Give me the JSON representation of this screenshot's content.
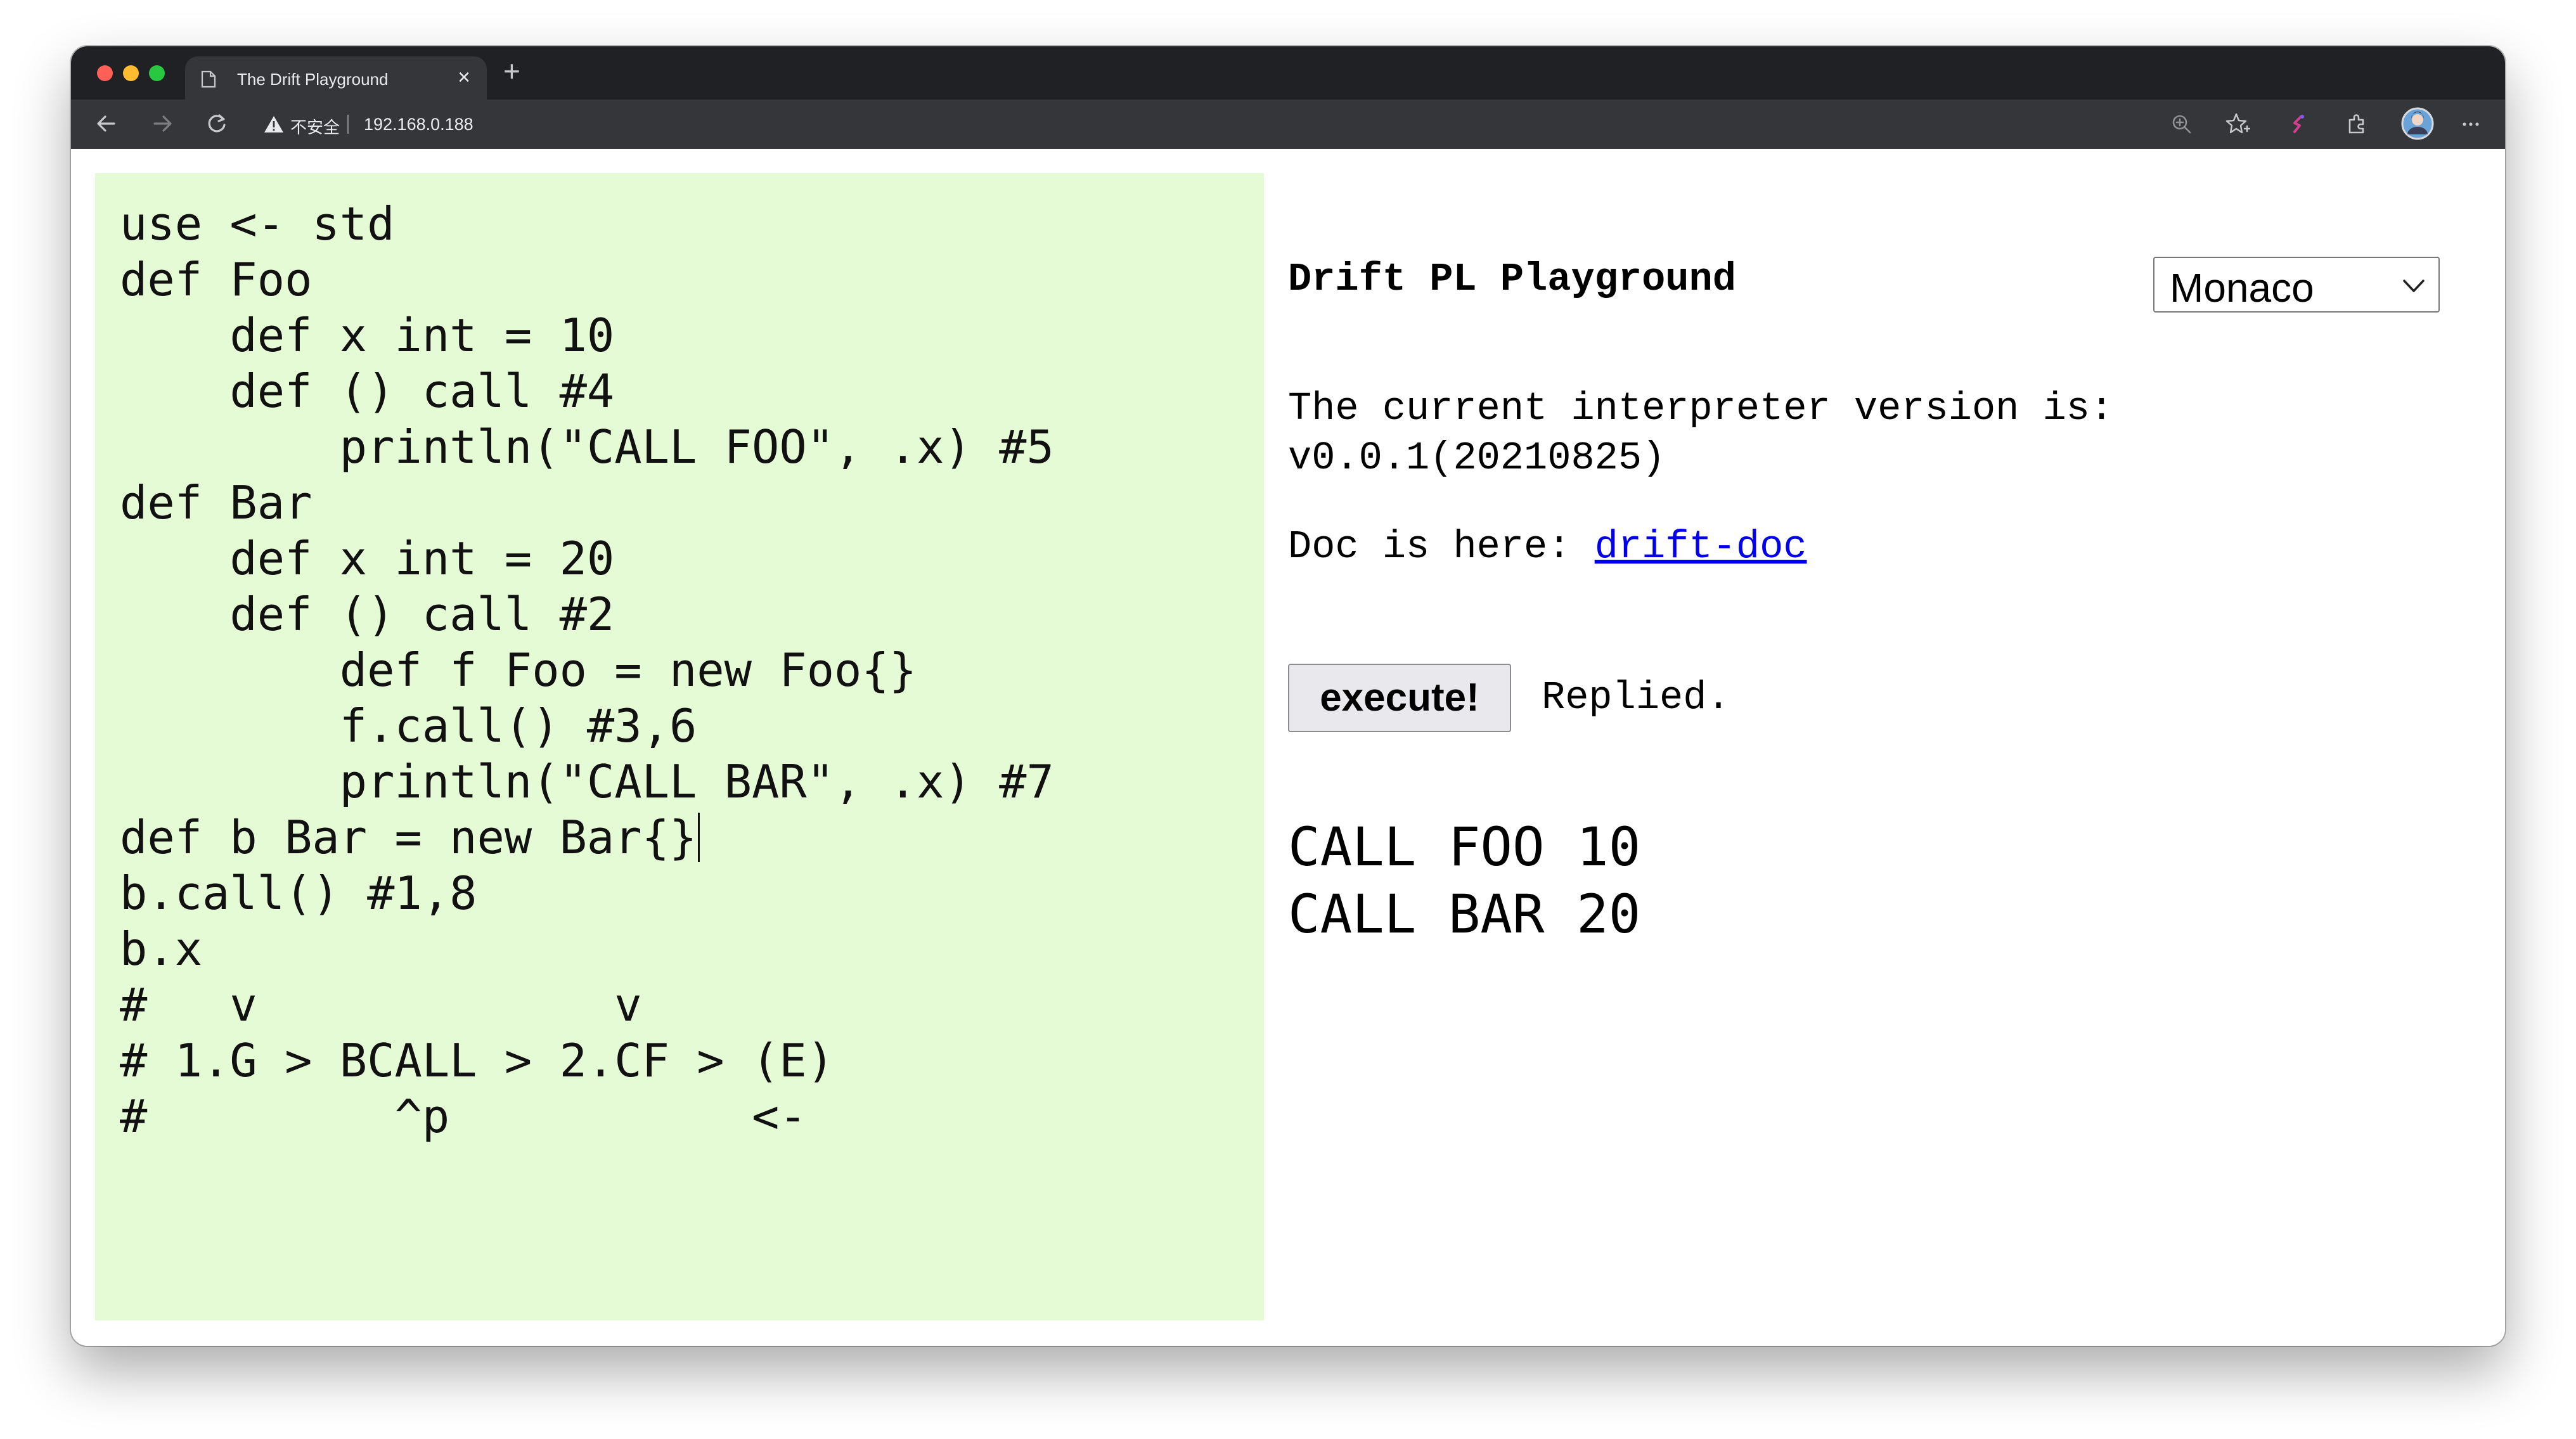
{
  "browser": {
    "tab_title": "The Drift Playground",
    "new_tab_symbol": "+",
    "close_tab_symbol": "×",
    "security_label": "不安全",
    "url": "192.168.0.188"
  },
  "editor": {
    "lines": [
      "use <- std",
      "def Foo",
      "    def x int = 10",
      "    def () call #4",
      "        println(\"CALL FOO\", .x) #5",
      "def Bar",
      "    def x int = 20",
      "    def () call #2",
      "        def f Foo = new Foo{}",
      "        f.call() #3,6",
      "        println(\"CALL BAR\", .x) #7",
      "def b Bar = new Bar{}",
      "b.call() #1,8",
      "b.x",
      "#   v             v",
      "# 1.G > BCALL > 2.CF > (E)",
      "#         ^p           <-"
    ],
    "background": "#e5fbd6"
  },
  "header": {
    "title": "Drift PL Playground",
    "font_select_value": "Monaco"
  },
  "info": {
    "version_text": "The current interpreter version is:",
    "version_value": "v0.0.1(20210825)",
    "doc_prefix": "Doc is here: ",
    "doc_link": "drift-doc"
  },
  "actions": {
    "execute_label": "execute!",
    "status": "Replied."
  },
  "output": {
    "lines": [
      "CALL FOO 10",
      "CALL BAR 20"
    ]
  },
  "icons": {
    "tab": "page-icon",
    "back": "arrow-left-icon",
    "forward": "arrow-right-icon",
    "reload": "reload-icon",
    "security": "warning-icon",
    "zoom": "zoom-icon",
    "bookmark": "star-icon",
    "extension1": "puzzle-brand-icon",
    "extension2": "extensions-icon",
    "profile": "avatar",
    "menu": "more-icon"
  },
  "colors": {
    "link": "#0000ee",
    "editor_bg": "#e5fbd6",
    "chrome_dark": "#202124",
    "toolbar": "#35363a"
  }
}
